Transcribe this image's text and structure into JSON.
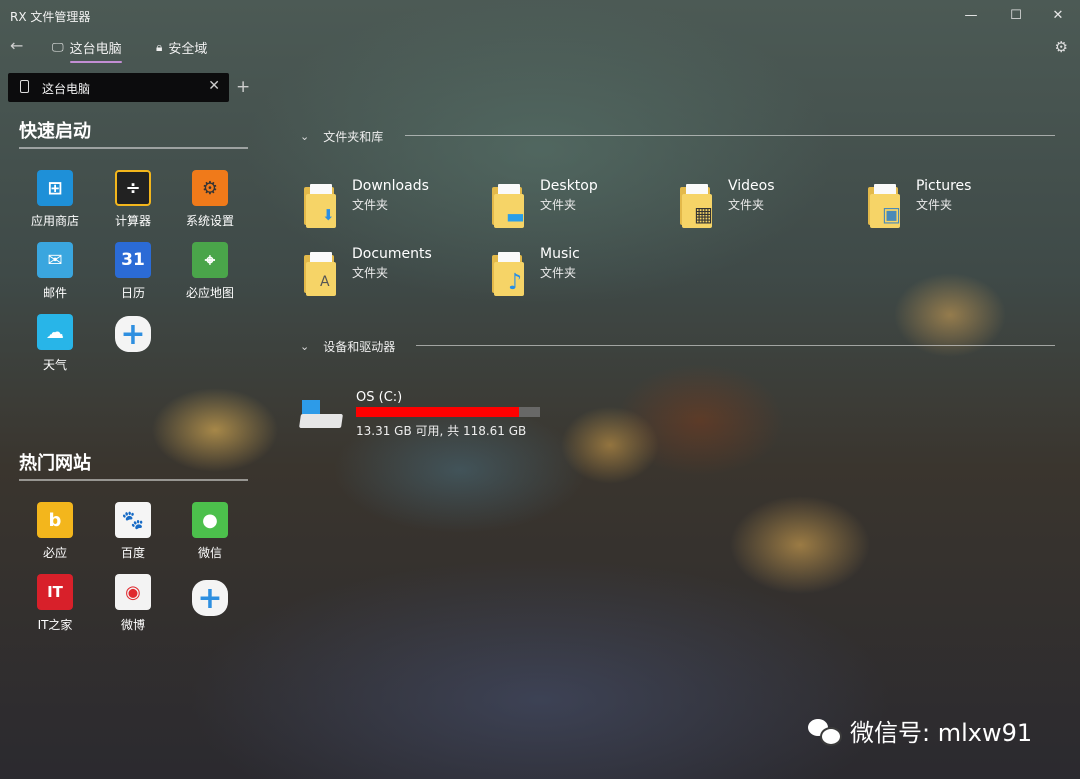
{
  "window": {
    "title": "RX 文件管理器",
    "minimize": "—",
    "maximize": "☐",
    "close": "✕"
  },
  "nav": {
    "back": "←",
    "tabs": [
      {
        "label": "这台电脑",
        "active": true
      },
      {
        "label": "安全域",
        "active": false
      }
    ],
    "settings": "⚙"
  },
  "tabstrip": {
    "tab_label": "这台电脑",
    "close": "✕",
    "add": "+"
  },
  "sidebar": {
    "quick_launch": {
      "title": "快速启动",
      "items": [
        {
          "label": "应用商店",
          "glyph": "⊞",
          "color": "#1e90d8"
        },
        {
          "label": "计算器",
          "glyph": "÷",
          "color": "#222222"
        },
        {
          "label": "系统设置",
          "glyph": "⚙",
          "color": "#f07a1a"
        },
        {
          "label": "邮件",
          "glyph": "✉",
          "color": "#3aa6df"
        },
        {
          "label": "日历",
          "glyph": "31",
          "color": "#2b6bd6"
        },
        {
          "label": "必应地图",
          "glyph": "⌖",
          "color": "#4aa54a"
        },
        {
          "label": "天气",
          "glyph": "☁",
          "color": "#28b5e8"
        },
        {
          "label": "",
          "glyph": "+",
          "color": "#2e8fe0"
        }
      ]
    },
    "popular_sites": {
      "title": "热门网站",
      "items": [
        {
          "label": "必应",
          "glyph": "b",
          "color": "#f3b61c"
        },
        {
          "label": "百度",
          "glyph": "🐾",
          "color": "#f5f5f5"
        },
        {
          "label": "微信",
          "glyph": "●",
          "color": "#4cc04c"
        },
        {
          "label": "IT之家",
          "glyph": "IT",
          "color": "#d8202a"
        },
        {
          "label": "微博",
          "glyph": "◉",
          "color": "#f3f3f3"
        },
        {
          "label": "",
          "glyph": "+",
          "color": "#2e8fe0"
        }
      ]
    }
  },
  "main": {
    "folders_group": {
      "title": "文件夹和库",
      "items": [
        {
          "name": "Downloads",
          "type": "文件夹",
          "badge": "⬇",
          "badge_color": "#2a8fe3"
        },
        {
          "name": "Desktop",
          "type": "文件夹",
          "badge": "▬",
          "badge_color": "#2a9ee8"
        },
        {
          "name": "Videos",
          "type": "文件夹",
          "badge": "▦",
          "badge_color": "#333333"
        },
        {
          "name": "Pictures",
          "type": "文件夹",
          "badge": "▣",
          "badge_color": "#4a8ab8"
        },
        {
          "name": "Documents",
          "type": "文件夹",
          "badge": "A",
          "badge_color": "#555555"
        },
        {
          "name": "Music",
          "type": "文件夹",
          "badge": "♪",
          "badge_color": "#2a8fe3"
        }
      ]
    },
    "drives_group": {
      "title": "设备和驱动器",
      "drives": [
        {
          "name": "OS (C:)",
          "info": "13.31 GB 可用, 共 118.61 GB",
          "used_fraction": 0.888,
          "bar_color": "#ff0000"
        }
      ]
    }
  },
  "watermark": {
    "text": "微信号: mlxw91"
  }
}
